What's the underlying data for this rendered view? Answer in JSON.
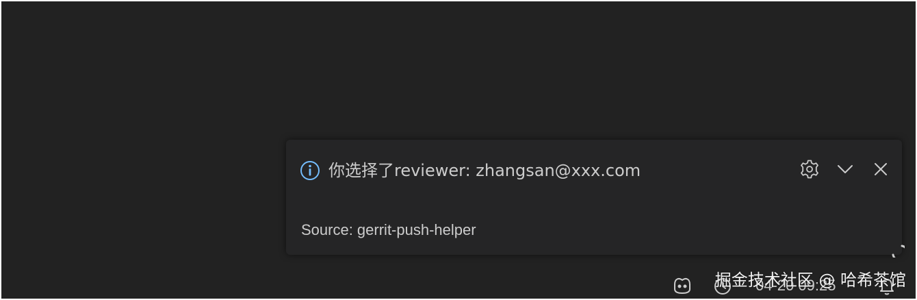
{
  "notification": {
    "message": "你选择了reviewer: zhangsan@xxx.com",
    "source": "Source: gerrit-push-helper",
    "type_icon": "info-icon",
    "actions": [
      {
        "icon": "gear-icon",
        "label": "settings"
      },
      {
        "icon": "chevron-down-icon",
        "label": "collapse"
      },
      {
        "icon": "close-icon",
        "label": "close"
      }
    ]
  },
  "statusbar": {
    "time": "04-20 09:25",
    "copilot_icon": "copilot-icon",
    "bell_icon": "bell-icon"
  },
  "watermark": "掘金技术社区 @ 哈希茶馆",
  "colors": {
    "background": "#222222",
    "toast_background": "#252526",
    "text": "#cccccc",
    "info_icon": "#75beff"
  }
}
